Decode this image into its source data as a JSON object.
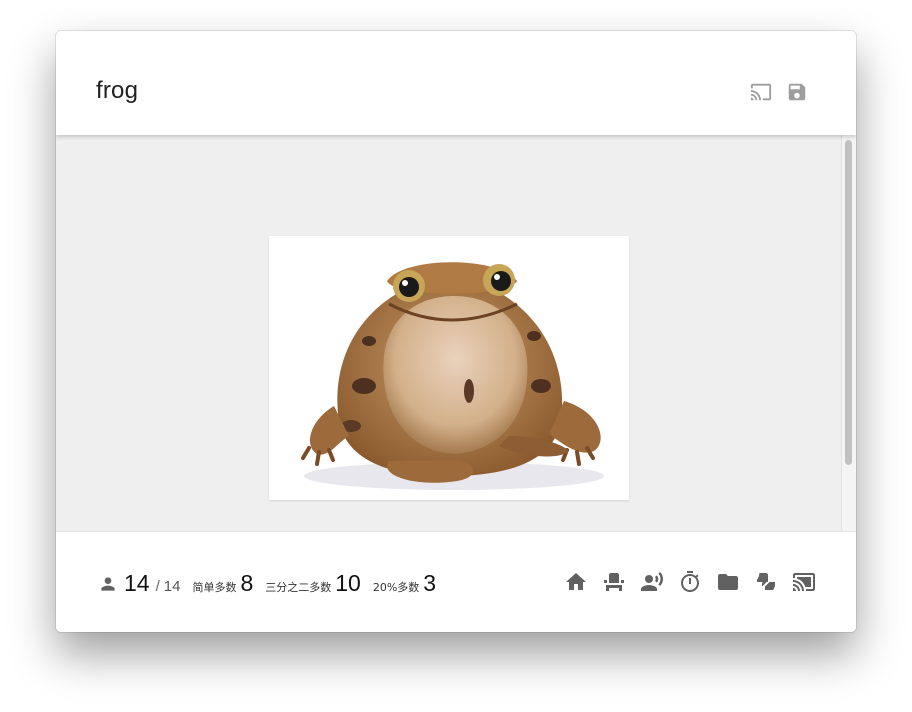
{
  "window": {
    "title": "frog"
  },
  "header": {
    "icons": [
      "cast-icon",
      "save-icon"
    ]
  },
  "image": {
    "subject": "frog"
  },
  "stats": {
    "responses": "14",
    "total": "14",
    "simple_majority_label": "简单多数",
    "simple_majority_value": "8",
    "two_thirds_label": "三分之二多数",
    "two_thirds_value": "10",
    "twenty_percent_label": "20%多数",
    "twenty_percent_value": "3"
  },
  "footer": {
    "icons": [
      "home-icon",
      "seat-icon",
      "speaker-icon",
      "timer-icon",
      "folder-icon",
      "thumbs-icon",
      "cast-icon"
    ]
  },
  "colors": {
    "accent_gray": "#616161",
    "content_bg": "#efefef"
  }
}
